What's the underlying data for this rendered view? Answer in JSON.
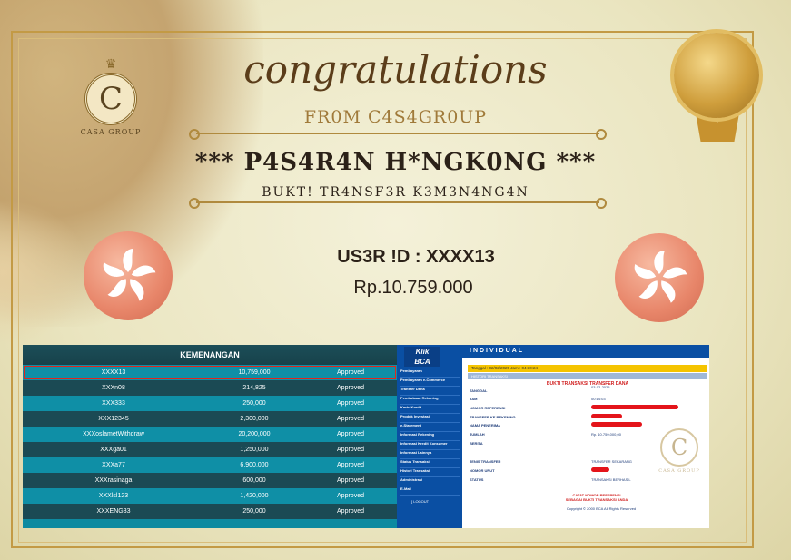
{
  "brand": {
    "name": "CASA GROUP",
    "monogram": "C",
    "crown": "♛"
  },
  "header": {
    "title": "congratulations",
    "from": "FR0M C4S4GR0UP",
    "headline": "*** P4S4R4N H*NGK0NG ***",
    "subline": "BUKT! TR4NSF3R K3M3N4NG4N"
  },
  "winner": {
    "user_id": "US3R !D : XXXX13",
    "amount": "Rp.10.759.000"
  },
  "kemenangan": {
    "title": "KEMENANGAN",
    "rows": [
      {
        "user": "XXXX13",
        "amount": "10,759,000",
        "status": "Approved",
        "highlight": true
      },
      {
        "user": "XXXn08",
        "amount": "214,825",
        "status": "Approved"
      },
      {
        "user": "XXX333",
        "amount": "250,000",
        "status": "Approved"
      },
      {
        "user": "XXX12345",
        "amount": "2,300,000",
        "status": "Approved"
      },
      {
        "user": "XXXoslametWithdraw",
        "amount": "20,200,000",
        "status": "Approved"
      },
      {
        "user": "XXXga01",
        "amount": "1,250,000",
        "status": "Approved"
      },
      {
        "user": "XXXa77",
        "amount": "6,900,000",
        "status": "Approved"
      },
      {
        "user": "XXXrasinaga",
        "amount": "600,000",
        "status": "Approved"
      },
      {
        "user": "XXXlsl123",
        "amount": "1,420,000",
        "status": "Approved"
      },
      {
        "user": "XXXENG33",
        "amount": "250,000",
        "status": "Approved"
      }
    ]
  },
  "bca": {
    "logo_top": "Klik",
    "logo_bottom": "BCA",
    "top": "INDIVIDUAL",
    "bar": "Tanggal : 02/02/2025 Jam : 04:30:24",
    "history": "HISTORI TRANSAKSI",
    "title": "BUKTI TRANSAKSI TRANSFER DANA",
    "menu": [
      "Pembayaran",
      "Pembayaran e-Commerce",
      "Transfer Dana",
      "Pembukaan Rekening",
      "Kartu Kredit",
      "Produk Investasi",
      "e-Statement",
      "Informasi Rekening",
      "Informasi Kredit Konsumer",
      "Informasi Lainnya",
      "Status Transaksi",
      "Histori Transaksi",
      "Administrasi",
      "E-Mail"
    ],
    "logoff": "[ LOGOUT ]",
    "fields": {
      "tanggal": "TANGGAL",
      "tanggal_val": "03-02-2025",
      "jam": "JAM",
      "jam_val": "00:14:03",
      "noref": "NOMOR REFERENSI",
      "ke_rek": "TRANSFER KE REKENING",
      "penerima": "NAMA PENERIMA",
      "jumlah": "JUMLAH",
      "jumlah_val": "Rp.       10.759.000,00",
      "berita": "BERITA",
      "jenis": "JENIS TRANSFER",
      "jenis_val": "TRANSFER SEKARANG",
      "urut": "NOMOR URUT",
      "status": "STATUS",
      "status_val": "TRANSAKSI BERHASIL"
    },
    "note1": "CATAT NOMOR REFERENSI",
    "note2": "SEBAGAI BUKTI TRANSAKSI ANDA",
    "footer": "Copyright © 2000  BCA  All Rights Reserved",
    "watermark": "CASA GROUP"
  },
  "colors": {
    "gold": "#c39a45",
    "teal": "#0f8fa6",
    "bca_blue": "#0a4fa3",
    "redact": "#e4141a"
  }
}
